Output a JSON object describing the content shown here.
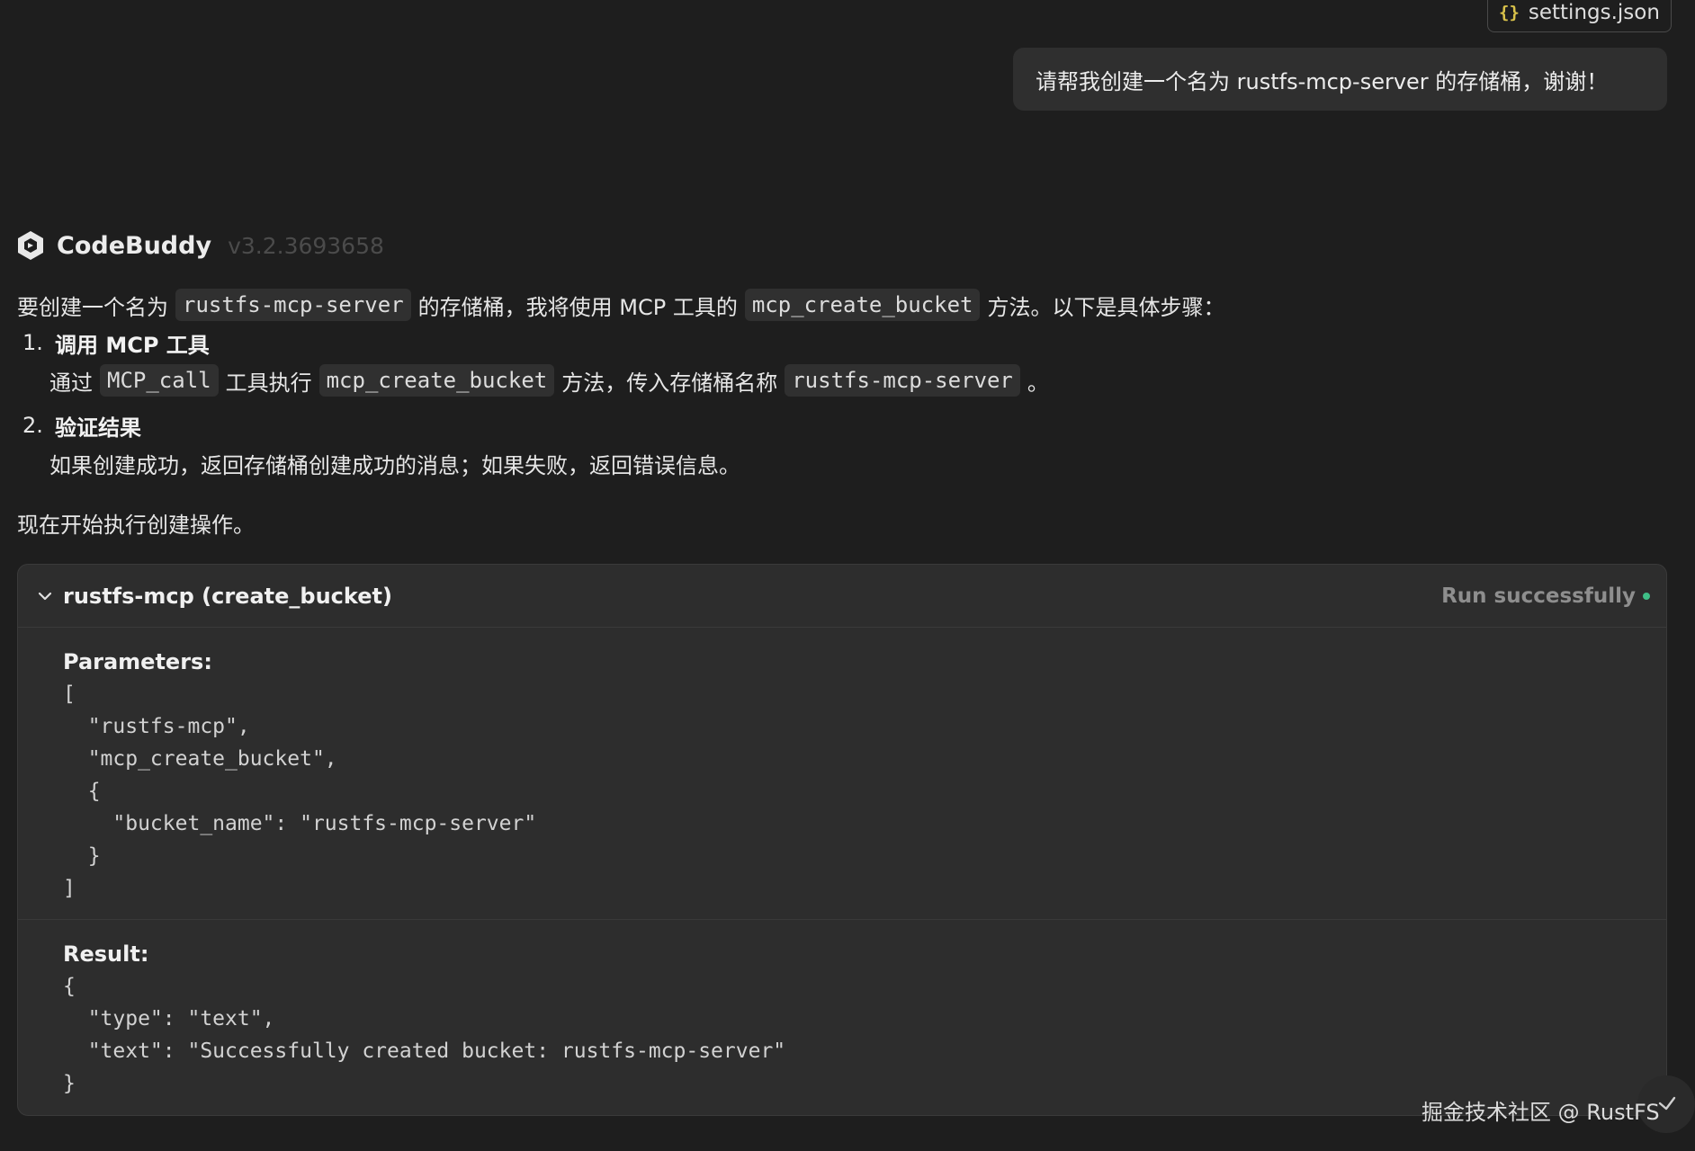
{
  "file_chip": {
    "icon": "json-braces-icon",
    "braces": "{}",
    "label": "settings.json"
  },
  "user_message": "请帮我创建一个名为 rustfs-mcp-server 的存储桶，谢谢！",
  "assistant": {
    "name": "CodeBuddy",
    "version": "v3.2.3693658",
    "intro": {
      "t1": "要创建一个名为",
      "c1": "rustfs-mcp-server",
      "t2": "的存储桶，我将使用 MCP 工具的",
      "c2": "mcp_create_bucket",
      "t3": "方法。以下是具体步骤："
    },
    "steps": [
      {
        "num": "1.",
        "title": "调用 MCP 工具",
        "d1": "通过",
        "c1": "MCP_call",
        "d2": "工具执行",
        "c2": "mcp_create_bucket",
        "d3": "方法，传入存储桶名称",
        "c3": "rustfs-mcp-server",
        "d4": "。"
      },
      {
        "num": "2.",
        "title": "验证结果",
        "desc": "如果创建成功，返回存储桶创建成功的消息；如果失败，返回错误信息。"
      }
    ],
    "closing": "现在开始执行创建操作。"
  },
  "tool_call": {
    "title": "rustfs-mcp (create_bucket)",
    "status": "Run successfully",
    "status_color": "#3fbf87",
    "params_label": "Parameters:",
    "params_lines": [
      "[",
      "  \"rustfs-mcp\",",
      "  \"mcp_create_bucket\",",
      "  {",
      "    \"bucket_name\": \"rustfs-mcp-server\"",
      "  }",
      "]"
    ],
    "result_label": "Result:",
    "result_lines": [
      "{",
      "  \"type\": \"text\",",
      "  \"text\": \"Successfully created bucket: rustfs-mcp-server\"",
      "}"
    ]
  },
  "watermark": "掘金技术社区 @ RustFS"
}
